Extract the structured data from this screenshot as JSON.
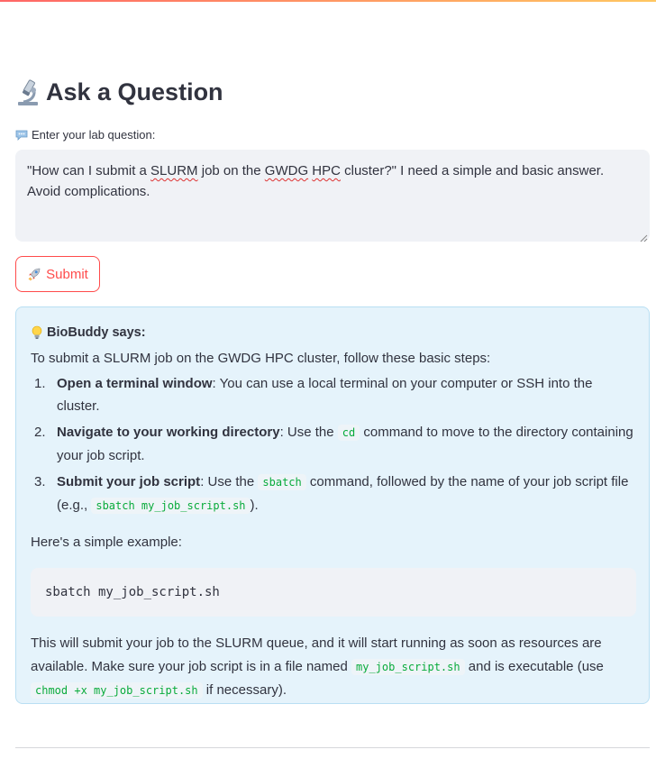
{
  "header": {
    "title": "Ask a Question",
    "title_icon": "microscope-icon"
  },
  "question": {
    "label": "Enter your lab question:",
    "label_icon": "speech-bubble-icon",
    "value_parts": [
      "\"How can I submit a ",
      "SLURM",
      " job on the ",
      "GWDG",
      " ",
      "HPC",
      " cluster?\" I need a simple and basic answer. Avoid complications."
    ]
  },
  "submit": {
    "label": "Submit",
    "icon": "rocket-icon",
    "accent": "#ff4b4b"
  },
  "answer": {
    "speaker": "BioBuddy says:",
    "speaker_icon": "lightbulb-icon",
    "intro": "To submit a SLURM job on the GWDG HPC cluster, follow these basic steps:",
    "steps": [
      {
        "num": "1.",
        "bold": "Open a terminal window",
        "text": ": You can use a local terminal on your computer or SSH into the cluster."
      },
      {
        "num": "2.",
        "bold": "Navigate to your working directory",
        "pre": ": Use the ",
        "code": "cd",
        "post": " command to move to the directory containing your job script."
      },
      {
        "num": "3.",
        "bold": "Submit your job script",
        "pre": ": Use the ",
        "code": "sbatch",
        "post": " command, followed by the name of your job script file (e.g., ",
        "code2": "sbatch my_job_script.sh",
        "post2": ")."
      }
    ],
    "example_label": "Here's a simple example:",
    "code_block": "sbatch my_job_script.sh",
    "outro_1": "This will submit your job to the SLURM queue, and it will start running as soon as resources are available. Make sure your job script is in a file named ",
    "outro_code1": "my_job_script.sh",
    "outro_2": " and is executable (use ",
    "outro_code2": "chmod +x my_job_script.sh",
    "outro_3": " if necessary).",
    "box_bg": "#e5f3fb",
    "code_color": "#09ab3b"
  }
}
